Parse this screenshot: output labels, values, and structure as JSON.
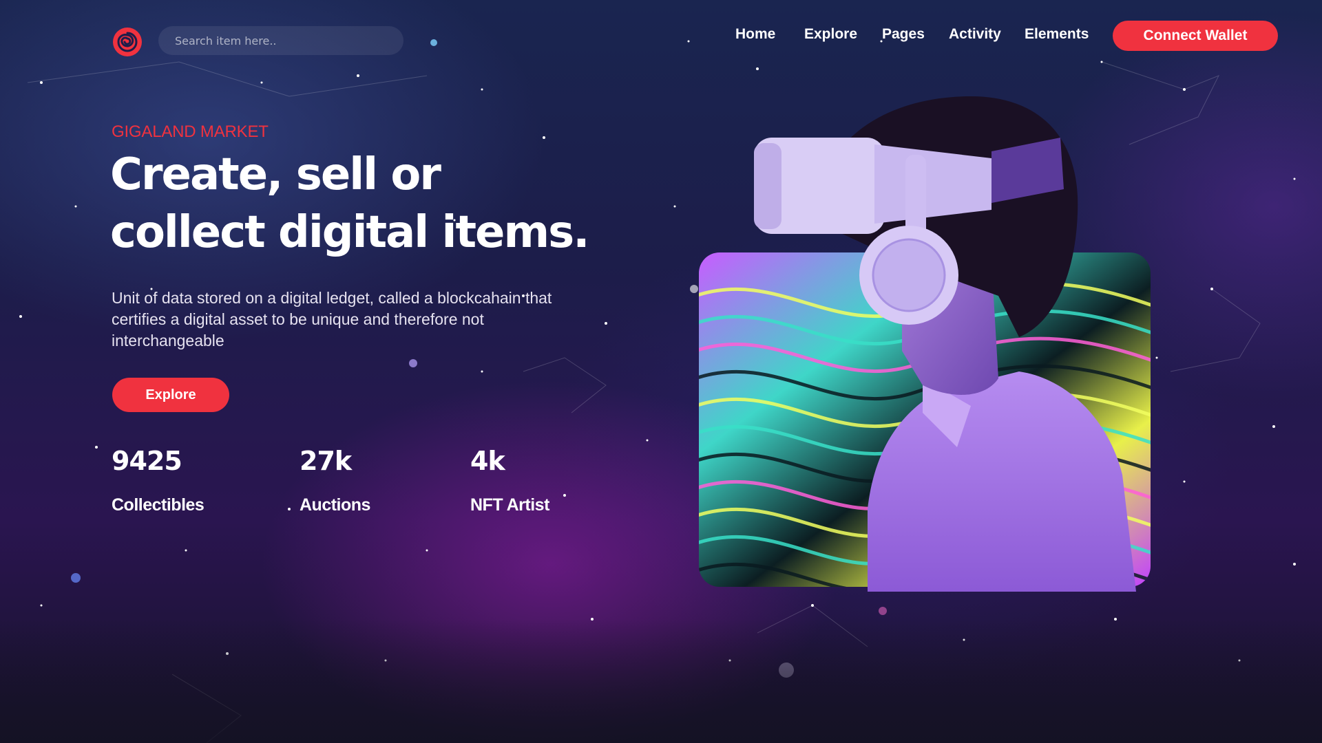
{
  "header": {
    "search_placeholder": "Search item here..",
    "nav": [
      "Home",
      "Explore",
      "Pages",
      "Activity",
      "Elements"
    ],
    "connect_label": "Connect Wallet"
  },
  "hero": {
    "eyebrow": "GIGALAND MARKET",
    "headline": "Create, sell or collect digital items.",
    "description": "Unit of data stored on a digital ledget, called a blockcahain that certifies a digital asset to be unique and therefore not interchangeable",
    "cta_label": "Explore",
    "stats": [
      {
        "value": "9425",
        "label": "Collectibles"
      },
      {
        "value": "27k",
        "label": "Auctions"
      },
      {
        "value": "4k",
        "label": "NFT Artist"
      }
    ]
  },
  "colors": {
    "accent": "#f0323f",
    "background": "#1c1d4a",
    "text": "#ffffff"
  },
  "icons": {
    "logo": "spiral-logo-icon",
    "hero_image": "vr-headset-person-illustration"
  }
}
